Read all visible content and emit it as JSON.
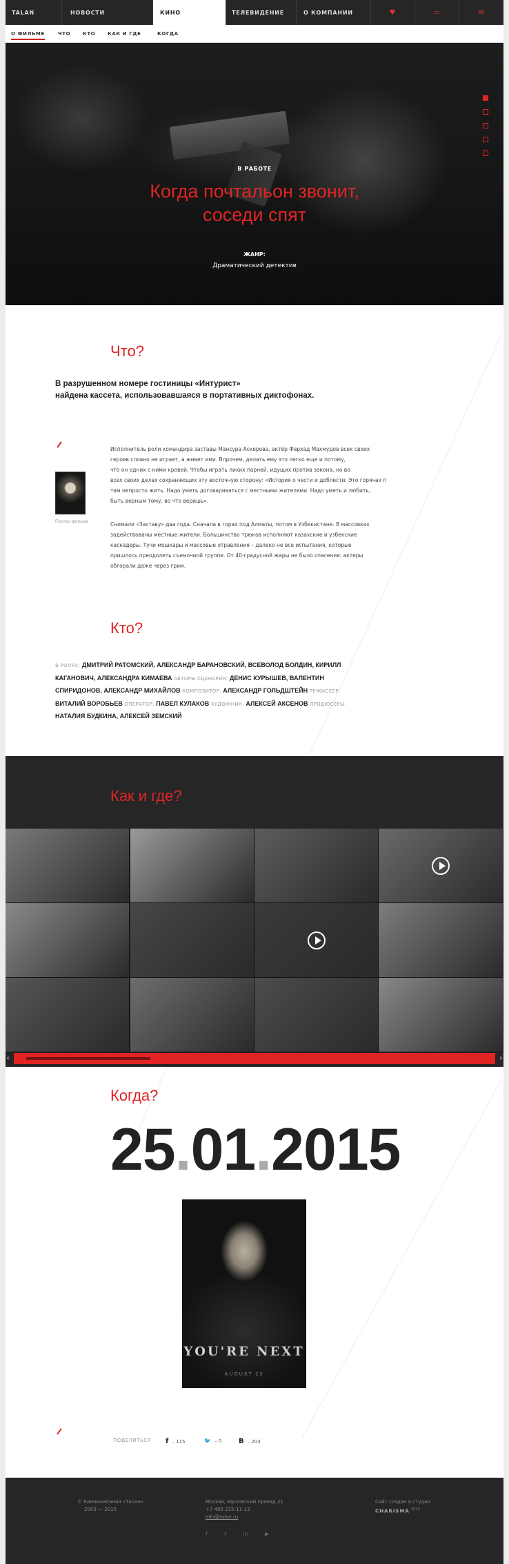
{
  "nav": {
    "items": [
      "TALAN",
      "НОВОСТИ",
      "КИНО",
      "ТЕЛЕВИДЕНИЕ",
      "О КОМПАНИИ"
    ],
    "icons": [
      "heart-icon",
      "flag-icon",
      "mail-icon"
    ],
    "icon_glyphs": [
      "♥",
      "▭",
      "✉"
    ]
  },
  "subnav": {
    "items": [
      "О ФИЛЬМЕ",
      "ЧТО",
      "КТО",
      "КАК И ГДЕ",
      "КОГДА"
    ]
  },
  "hero": {
    "status": "В РАБОТЕ",
    "title_line1": "Когда почтальон звонит,",
    "title_line2": "соседи спят",
    "genre_label": "ЖАНР:",
    "genre_value": "Драматический детектив",
    "slides_total": 5,
    "slide_active": 1
  },
  "what": {
    "title": "Что?",
    "lead_line1": "В разрушенном номере гостиницы «Интурист»",
    "lead_line2": "найдена кассета, использовавшаяся в портативных диктофонах.",
    "poster_caption": "Постер фильма",
    "p1_lines": [
      "Исполнитель роли командира заставы Мансура Аскерова, актёр Фархад Махмудов всех своих",
      "героев словно не играет, а живет ими. Впрочем, делать ему это легко еще и потому,",
      "что он одних с ними кровей. Чтобы играть лихих парней, идущих против закона, но во",
      "всех своих делах сохраняющих эту восточную сторону: «История о чести и доблести. Это горячая почва. Там тяжело,",
      "там непросто жить. Надо уметь договариваться с местными жителями. Надо уметь и любить,",
      "быть верным тому, во что веришь»."
    ],
    "p2_lines": [
      "Снимали «Заставу» два года. Сначала в горах под Алматы, потом в Узбекистане. В массовках",
      "задействованы местные жители. Большинство трюков исполняют казахские и узбекские",
      "каскадеры. Тучи мошкары и массовые отравления – далеко не все испытания, которые",
      "пришлось преодолеть съемочной группе. От 40-градусной жары не было спасения: актеры",
      "обгорали даже через грим."
    ]
  },
  "who": {
    "title": "Кто?",
    "credits": [
      {
        "role": "В РОЛЯХ:",
        "names": "ДМИТРИЙ РАТОМСКИЙ, АЛЕКСАНДР БАРАНОВСКИЙ, ВСЕВОЛОД БОЛДИН, КИРИЛЛ КАГАНОВИЧ, АЛЕКСАНДРА КИМАЕВА"
      },
      {
        "role": "АВТОРЫ СЦЕНАРИЯ:",
        "names": "ДЕНИС КУРЫШЕВ, ВАЛЕНТИН СПИРИДОНОВ, АЛЕКСАНДР МИХАЙЛОВ"
      },
      {
        "role": "КОМПОЗИТОР:",
        "names": "АЛЕКСАНДР ГОЛЬДШТЕЙН"
      },
      {
        "role": "РЕЖИССЕР:",
        "names": "ВИТАЛИЙ ВОРОБЬЕВ"
      },
      {
        "role": "ОПЕРАТОР:",
        "names": "ПАВЕЛ КУЛАКОВ"
      },
      {
        "role": "ХУДОЖНИК:",
        "names": "АЛЕКСЕЙ АКСЕНОВ"
      },
      {
        "role": "ПРОДЮСЕРЫ:",
        "names": "НАТАЛИЯ БУДКИНА, АЛЕКСЕЙ ЗЕМСКИЙ"
      }
    ]
  },
  "how": {
    "title": "Как и где?",
    "tiles": [
      {
        "shade": "#7a7a7a",
        "video": false
      },
      {
        "shade": "#9a9a9a",
        "video": false
      },
      {
        "shade": "#5c5c5c",
        "video": false
      },
      {
        "shade": "#6a6a6a",
        "video": true
      },
      {
        "shade": "#8a8a8a",
        "video": false
      },
      {
        "shade": "#474747",
        "video": false
      },
      {
        "shade": "#3a3a3a",
        "video": true
      },
      {
        "shade": "#7d7d7d",
        "video": false
      },
      {
        "shade": "#555555",
        "video": false
      },
      {
        "shade": "#6e6e6e",
        "video": false
      },
      {
        "shade": "#4c4c4c",
        "video": false
      },
      {
        "shade": "#888888",
        "video": false
      },
      {
        "shade": "#b0b0b0",
        "video": false
      },
      {
        "shade": "#9c9c9c",
        "video": false
      },
      {
        "shade": "#767676",
        "video": true
      },
      {
        "shade": "#505050",
        "video": false
      }
    ],
    "scroll_left": "‹",
    "scroll_right": "›"
  },
  "when": {
    "title": "Когда?",
    "day": "25",
    "month": "01",
    "year": "2015",
    "sep": ".",
    "poster_title": "YOU'RE NEXT",
    "poster_date": "AUGUST 23"
  },
  "share": {
    "label": "ПОДЕЛИТЬСЯ",
    "fb_icon": "f",
    "fb_count": "– 115",
    "tw_icon": "🐦",
    "tw_count": "– 0",
    "vk_icon": "В",
    "vk_count": "– 203"
  },
  "footer": {
    "copyright_line1": "© Кинокомпания «Талан»",
    "copyright_line2": "2003 — 2015",
    "address_line1": "Москва, Юрловский проезд 21",
    "address_line2": "+7 495 215-11-13",
    "email": "info@talan.ru",
    "studio_line1": "Сайт создан в студии",
    "studio_name": "CHARISMA",
    "studio_year": "2015",
    "social_icons": [
      "f",
      "t",
      "in",
      "▶"
    ]
  },
  "colors": {
    "accent": "#e02424",
    "dark": "#262626"
  }
}
